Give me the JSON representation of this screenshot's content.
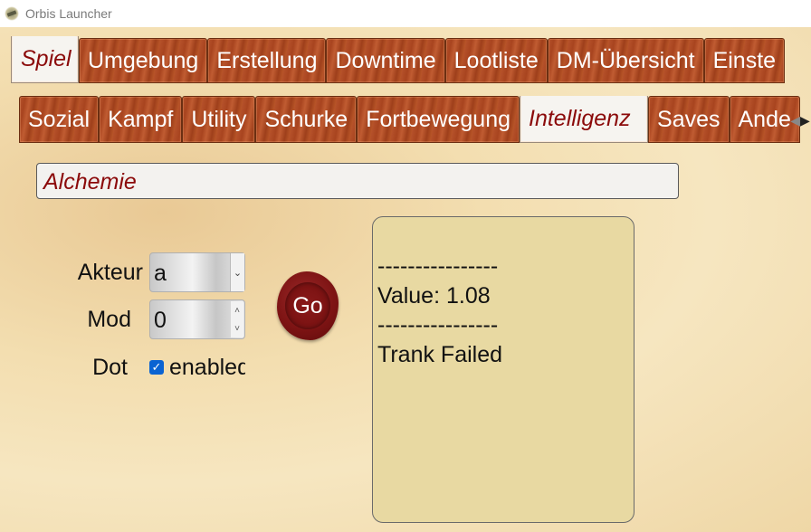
{
  "window": {
    "title": "Orbis Launcher",
    "icon": "orbis-app-icon"
  },
  "main_tabs": [
    {
      "label": "Spiel",
      "active": true
    },
    {
      "label": "Umgebung",
      "active": false
    },
    {
      "label": "Erstellung",
      "active": false
    },
    {
      "label": "Downtime",
      "active": false
    },
    {
      "label": "Lootliste",
      "active": false
    },
    {
      "label": "DM-Übersicht",
      "active": false
    },
    {
      "label": "Einste",
      "active": false
    }
  ],
  "sub_tabs": [
    {
      "label": "Sozial",
      "active": false
    },
    {
      "label": "Kampf",
      "active": false
    },
    {
      "label": "Utility",
      "active": false
    },
    {
      "label": "Schurke",
      "active": false
    },
    {
      "label": "Fortbewegung",
      "active": false
    },
    {
      "label": "Intelligenz",
      "active": true
    },
    {
      "label": "Saves",
      "active": false
    },
    {
      "label": "Ande",
      "active": false
    }
  ],
  "section": {
    "title": "Alchemie"
  },
  "form": {
    "akteur_label": "Akteur",
    "akteur_value": "a",
    "mod_label": "Mod",
    "mod_value": "0",
    "dot_label": "Dot",
    "dot_checkbox_label": "enabled",
    "dot_checked": true
  },
  "go_button": {
    "label": "Go"
  },
  "output": {
    "lines": [
      "----------------",
      "Value: 1.08",
      "----------------",
      "Trank Failed"
    ]
  },
  "colors": {
    "tab_wood": "#b5512a",
    "active_tab_text": "#8b0a0a",
    "output_bg": "#e8d9a2",
    "seal": "#7e1414",
    "checkbox": "#0a63d2"
  }
}
